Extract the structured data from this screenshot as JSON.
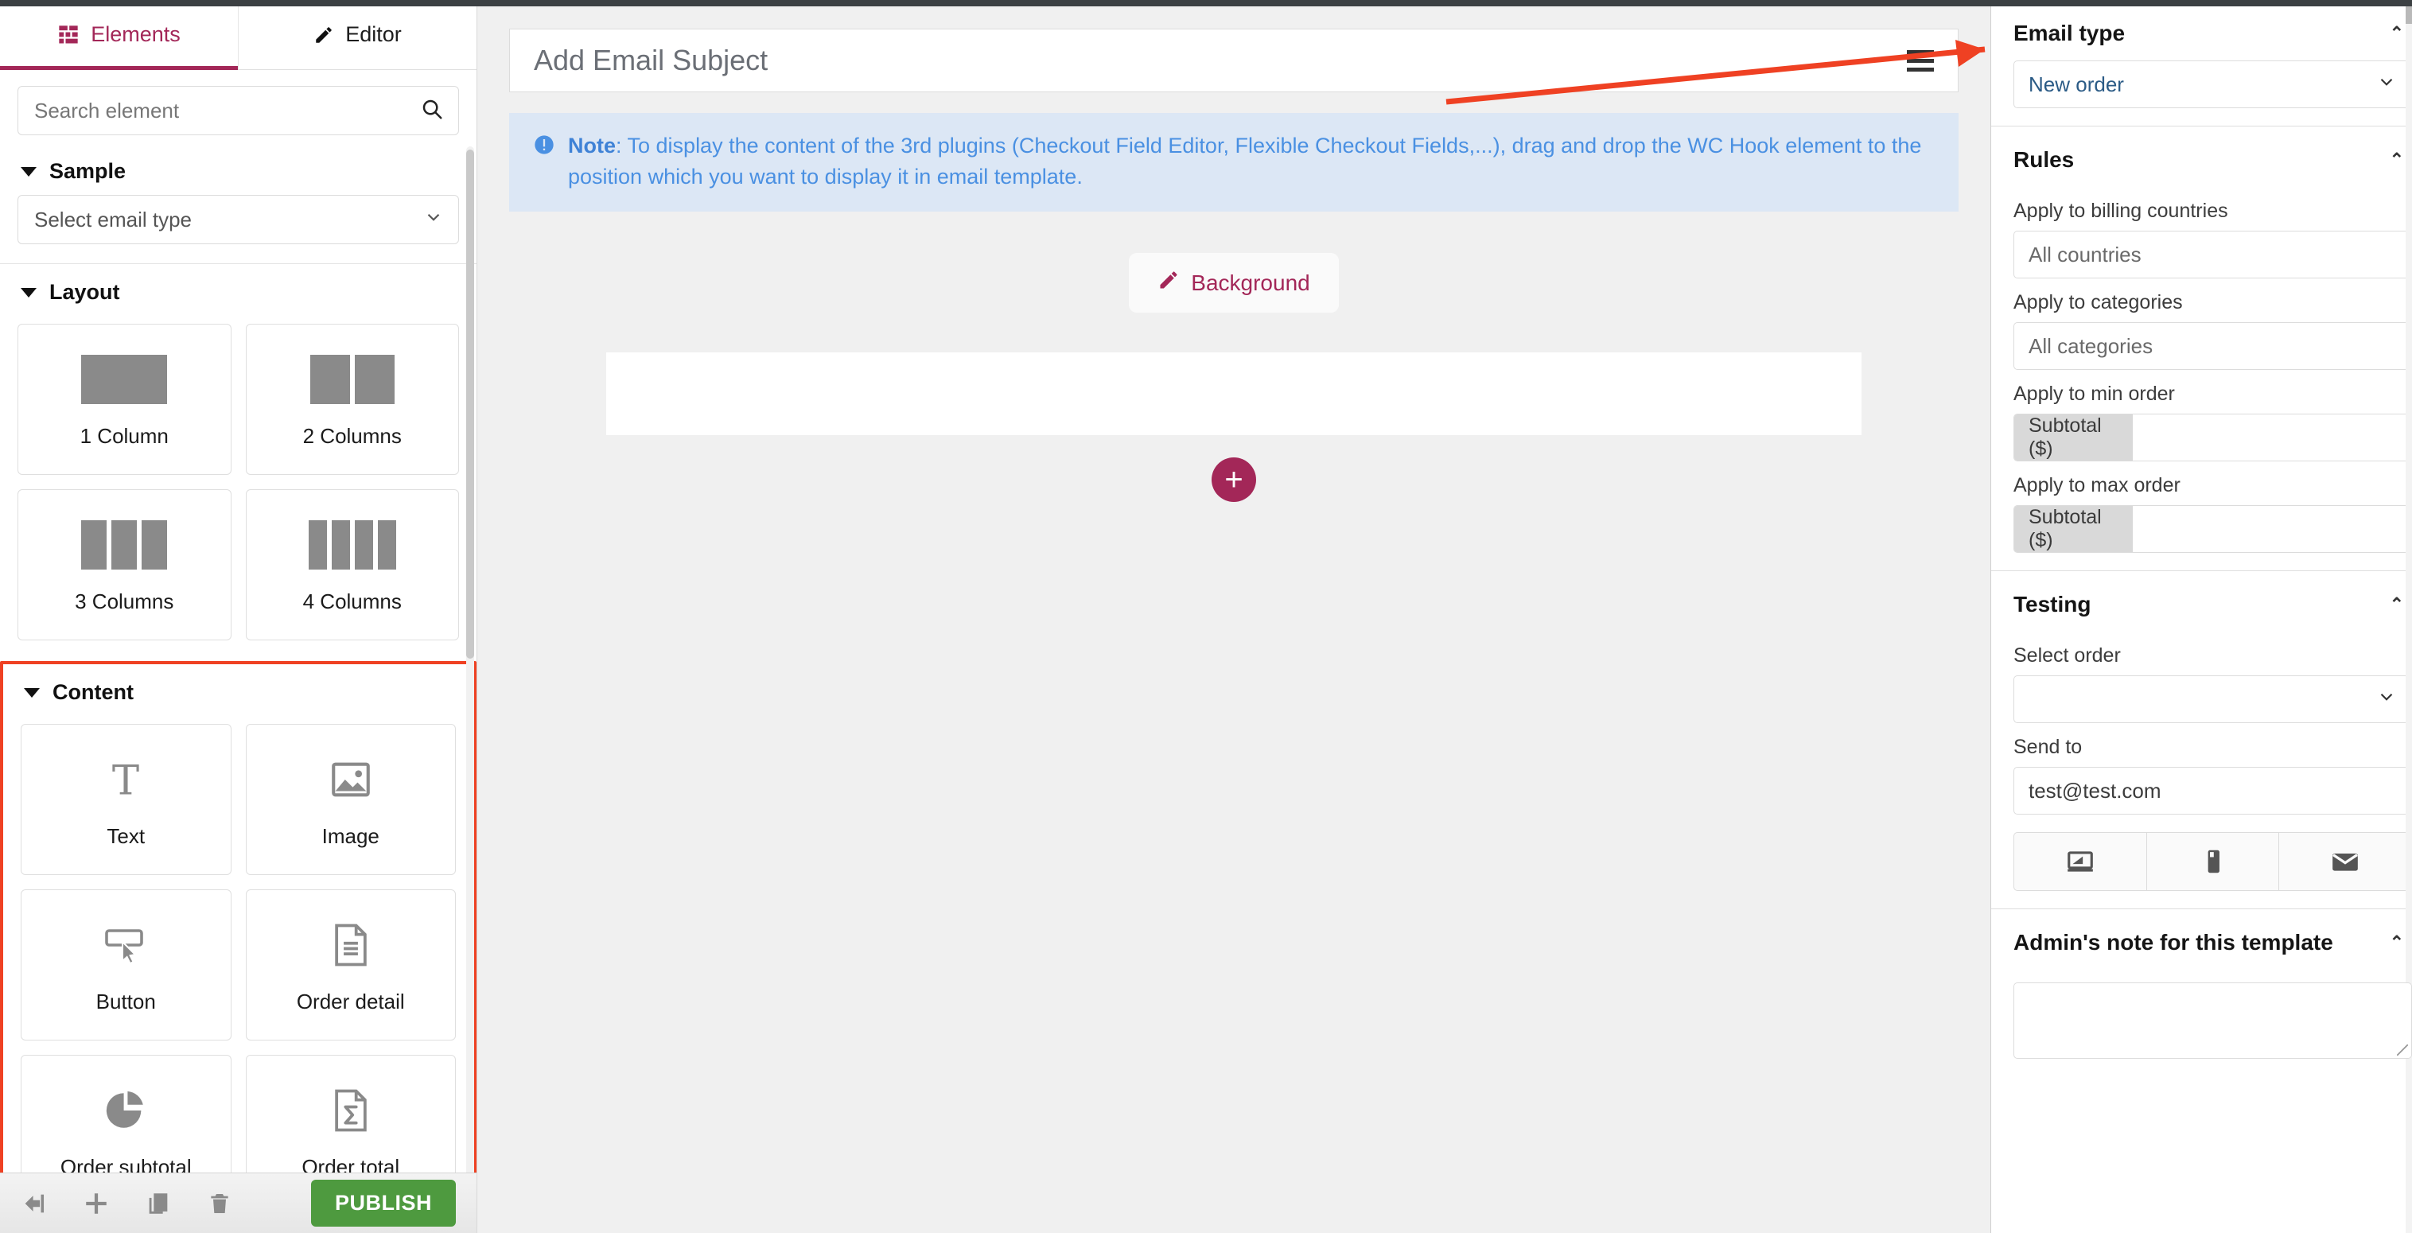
{
  "sidebar": {
    "tabs": [
      {
        "label": "Elements",
        "icon": "grid-icon",
        "active": true
      },
      {
        "label": "Editor",
        "icon": "pencil-icon",
        "active": false
      }
    ],
    "search": {
      "placeholder": "Search element",
      "value": "",
      "icon": "search-icon"
    },
    "sections": [
      {
        "id": "sample",
        "title": "Sample",
        "select": {
          "placeholder": "Select email type",
          "value": "",
          "icon": "chevron-down-icon"
        }
      },
      {
        "id": "layout",
        "title": "Layout",
        "cards": [
          {
            "label": "1 Column",
            "icon": "layout-1-column-icon",
            "cols": 1
          },
          {
            "label": "2 Columns",
            "icon": "layout-2-columns-icon",
            "cols": 2
          },
          {
            "label": "3 Columns",
            "icon": "layout-3-columns-icon",
            "cols": 3
          },
          {
            "label": "4 Columns",
            "icon": "layout-4-columns-icon",
            "cols": 4
          }
        ]
      },
      {
        "id": "content",
        "title": "Content",
        "highlighted": true,
        "highlight_color": "#ef4123",
        "cards": [
          {
            "label": "Text",
            "icon": "text-t-icon"
          },
          {
            "label": "Image",
            "icon": "image-icon"
          },
          {
            "label": "Button",
            "icon": "button-cursor-icon"
          },
          {
            "label": "Order detail",
            "icon": "document-lines-icon"
          },
          {
            "label": "Order subtotal",
            "icon": "pie-chart-icon"
          },
          {
            "label": "Order total",
            "icon": "document-sigma-icon"
          }
        ]
      }
    ],
    "bottom_bar": {
      "icons": [
        {
          "name": "back-arrow-icon"
        },
        {
          "name": "add-icon"
        },
        {
          "name": "duplicate-icon"
        },
        {
          "name": "trash-icon"
        }
      ],
      "publish_label": "PUBLISH",
      "publish_color": "#4e9a3f"
    }
  },
  "canvas": {
    "subject": {
      "value": "",
      "placeholder": "Add Email Subject",
      "menu_icon": "hamburger-icon"
    },
    "note": {
      "icon": "info-icon",
      "label": "Note",
      "text": ": To display the content of the 3rd plugins (Checkout Field Editor, Flexible Checkout Fields,...), drag and drop the WC Hook element to the position which you want to display it in email template.",
      "bg_color": "#dce7f5",
      "text_color": "#4a90e2"
    },
    "background_button": {
      "label": "Background",
      "icon": "pencil-icon",
      "color": "#a32758"
    },
    "add_block_button": {
      "label": "+",
      "icon": "plus-circle-icon",
      "color": "#a32758"
    }
  },
  "right_panel": {
    "email_type": {
      "title": "Email type",
      "select_value": "New order",
      "chevron": "chevron-down-icon"
    },
    "rules": {
      "title": "Rules",
      "fields": [
        {
          "label": "Apply to billing countries",
          "placeholder": "All countries",
          "type": "text"
        },
        {
          "label": "Apply to categories",
          "placeholder": "All categories",
          "type": "text"
        },
        {
          "label": "Apply to min order",
          "prefix": "Subtotal ($)",
          "value": "",
          "type": "prefixed"
        },
        {
          "label": "Apply to max order",
          "prefix": "Subtotal ($)",
          "value": "",
          "type": "prefixed"
        }
      ]
    },
    "testing": {
      "title": "Testing",
      "select_order_label": "Select order",
      "select_order_value": "",
      "send_to_label": "Send to",
      "send_to_value": "test@test.com",
      "devices": [
        {
          "name": "desktop-icon"
        },
        {
          "name": "mobile-icon"
        },
        {
          "name": "envelope-icon"
        }
      ]
    },
    "admin_note": {
      "title": "Admin's note for this template",
      "value": ""
    }
  },
  "annotation": {
    "arrow_color": "#ef4123",
    "highlight_color": "#ef4123"
  }
}
